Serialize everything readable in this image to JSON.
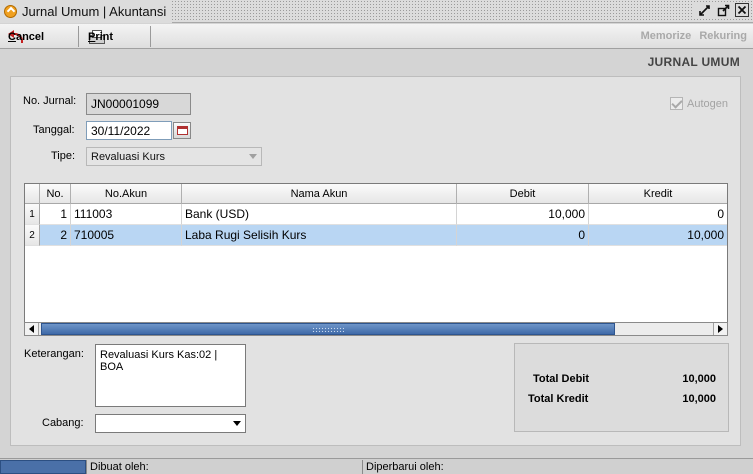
{
  "window": {
    "title": "Jurnal Umum | Akuntansi",
    "buttons": [
      "restore-icon",
      "maximize-icon",
      "close-icon"
    ]
  },
  "toolbar": {
    "cancel_label": "Cancel",
    "print_label": "Print",
    "memorize_label": "Memorize",
    "rekuring_label": "Rekuring"
  },
  "section_title": "JURNAL UMUM",
  "form": {
    "no_jurnal_label": "No. Jurnal:",
    "no_jurnal_value": "JN00001099",
    "tanggal_label": "Tanggal:",
    "tanggal_value": "30/11/2022",
    "tipe_label": "Tipe:",
    "tipe_value": "Revaluasi Kurs",
    "autogen_label": "Autogen",
    "autogen_checked": true
  },
  "grid": {
    "columns": [
      "No.",
      "No.Akun",
      "Nama Akun",
      "Debit",
      "Kredit"
    ],
    "rows": [
      {
        "row_header": "1",
        "no": "1",
        "no_akun": "111003",
        "nama_akun": "Bank (USD)",
        "debit": "10,000",
        "kredit": "0"
      },
      {
        "row_header": "2",
        "no": "2",
        "no_akun": "710005",
        "nama_akun": "Laba Rugi Selisih Kurs",
        "debit": "0",
        "kredit": "10,000"
      }
    ],
    "selected_row": 2
  },
  "keterangan": {
    "label": "Keterangan:",
    "value": "Revaluasi Kurs Kas:02 | BOA"
  },
  "cabang": {
    "label": "Cabang:",
    "value": ""
  },
  "totals": {
    "debit_label": "Total Debit",
    "debit_value": "10,000",
    "kredit_label": "Total Kredit",
    "kredit_value": "10,000"
  },
  "status": {
    "dibuat_label": "Dibuat oleh:",
    "diperbarui_label": "Diperbarui oleh:"
  }
}
